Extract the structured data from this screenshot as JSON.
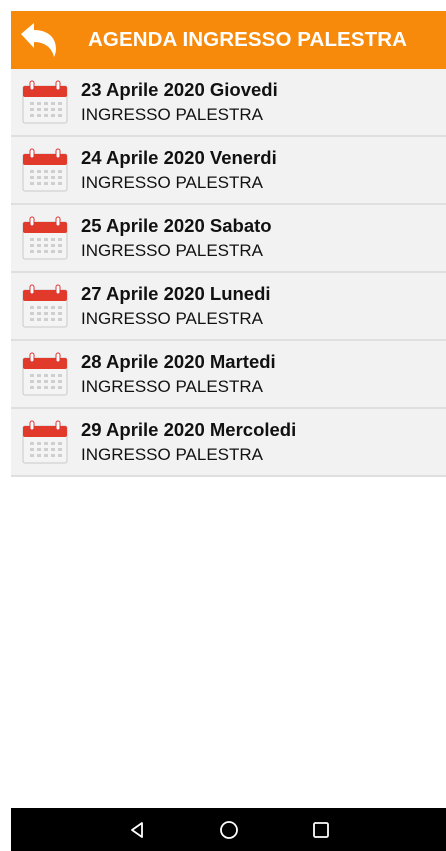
{
  "header": {
    "title": "AGENDA INGRESSO PALESTRA",
    "back_icon": "back-arrow-icon"
  },
  "colors": {
    "header_bg": "#f78a0b",
    "list_bg": "#f2f2f2",
    "divider": "#dfdfdf",
    "calendar_red": "#e13a2b"
  },
  "list": {
    "items": [
      {
        "date": "23 Aprile 2020 Giovedi",
        "subtitle": "INGRESSO PALESTRA",
        "icon": "calendar-icon"
      },
      {
        "date": "24 Aprile 2020 Venerdi",
        "subtitle": "INGRESSO PALESTRA",
        "icon": "calendar-icon"
      },
      {
        "date": "25 Aprile 2020 Sabato",
        "subtitle": "INGRESSO PALESTRA",
        "icon": "calendar-icon"
      },
      {
        "date": "27 Aprile 2020 Lunedi",
        "subtitle": "INGRESSO PALESTRA",
        "icon": "calendar-icon"
      },
      {
        "date": "28 Aprile 2020 Martedi",
        "subtitle": "INGRESSO PALESTRA",
        "icon": "calendar-icon"
      },
      {
        "date": "29 Aprile 2020 Mercoledi",
        "subtitle": "INGRESSO PALESTRA",
        "icon": "calendar-icon"
      }
    ]
  },
  "navbar": {
    "back_icon": "nav-back-icon",
    "home_icon": "nav-home-icon",
    "recents_icon": "nav-recents-icon"
  }
}
